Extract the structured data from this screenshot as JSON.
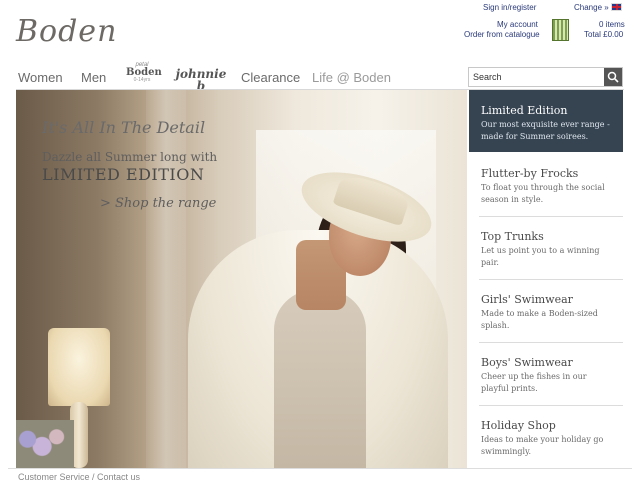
{
  "brand": {
    "logo_text": "Boden"
  },
  "header": {
    "sign_in": "Sign in/register",
    "change": "Change »",
    "my_account": "My account",
    "order_catalogue": "Order from catalogue",
    "items": "0 items",
    "total": "Total £0.00"
  },
  "nav": {
    "women": "Women",
    "men": "Men",
    "mini_top": "petal",
    "mini_main": "Boden",
    "mini_sub": "0-14yrs",
    "johnnie_main": "johnnie b",
    "johnnie_sub": "10-16yrs",
    "clearance": "Clearance",
    "life": "Life @ Boden"
  },
  "search": {
    "placeholder": "Search"
  },
  "hero": {
    "tagline": "It's All In The Detail",
    "subline": "Dazzle all Summer long with",
    "headline": "LIMITED EDITION",
    "link": "> Shop the range"
  },
  "sidebar": {
    "items": [
      {
        "title": "Limited Edition",
        "desc": "Our most exquisite ever range - made for Summer soirees."
      },
      {
        "title": "Flutter-by Frocks",
        "desc": "To float you through the social season in style."
      },
      {
        "title": "Top Trunks",
        "desc": "Let us point you to a winning pair."
      },
      {
        "title": "Girls' Swimwear",
        "desc": "Made to make a Boden-sized splash."
      },
      {
        "title": "Boys' Swimwear",
        "desc": "Cheer up the fishes in our playful prints."
      },
      {
        "title": "Holiday Shop",
        "desc": "Ideas to make your holiday go swimmingly."
      }
    ]
  },
  "footer": {
    "text": "Customer Service / Contact us"
  },
  "colors": {
    "active_sidebar": "#364452",
    "link_blue": "#2a3a7a"
  }
}
